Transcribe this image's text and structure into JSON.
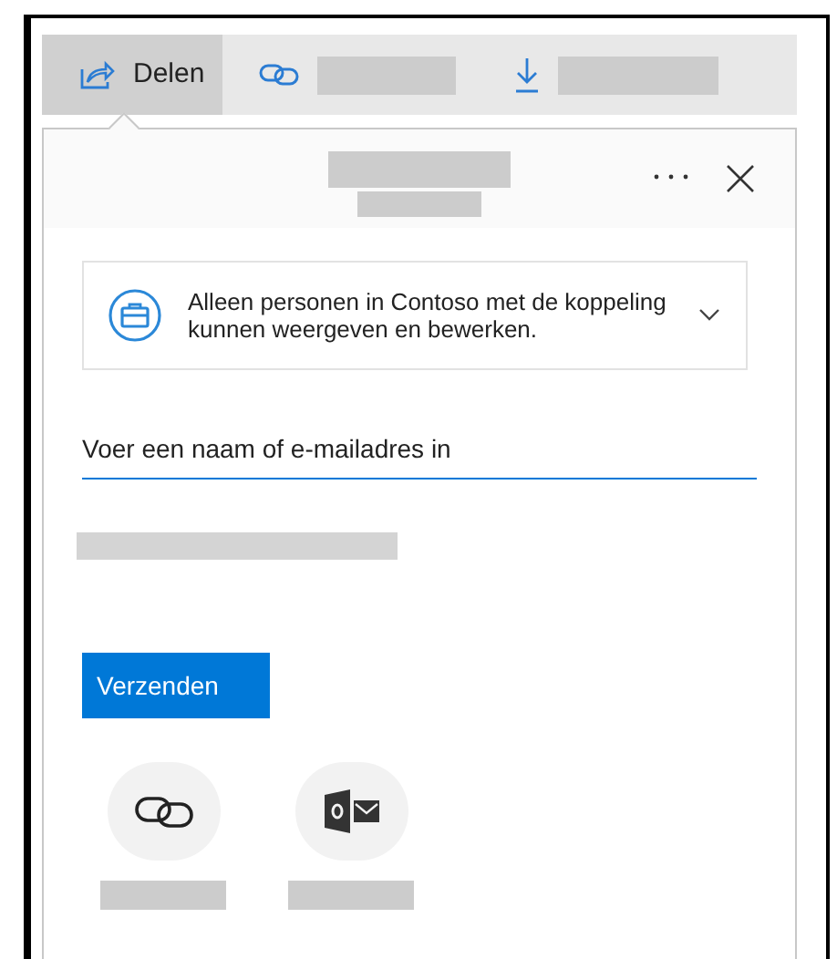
{
  "toolbar": {
    "tabs": [
      {
        "label": "Delen",
        "selected": true
      },
      {
        "selected": false
      },
      {
        "selected": false
      }
    ]
  },
  "share_panel": {
    "permission": {
      "text": "Alleen personen in Contoso met de koppeling kunnen weergeven en bewerken."
    },
    "recipient_field": {
      "placeholder": "Voer een naam of e-mailadres in"
    },
    "send_button": "Verzenden"
  }
}
